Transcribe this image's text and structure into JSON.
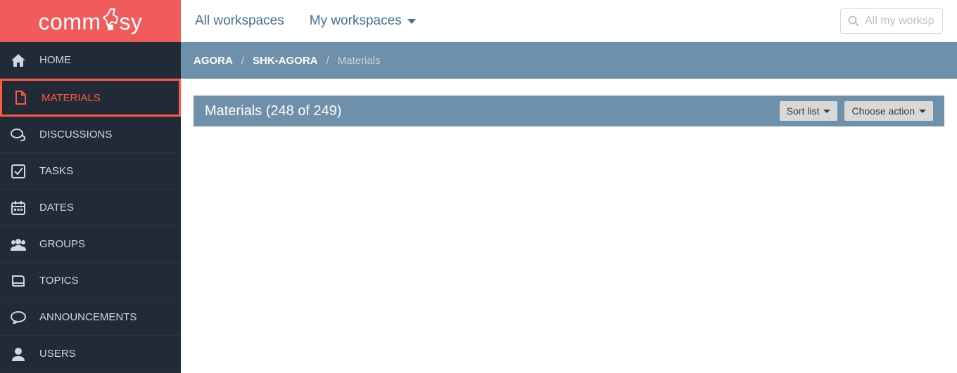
{
  "logo": {
    "text_prefix": "comm",
    "text_suffix": "sy"
  },
  "sidebar": {
    "items": [
      {
        "id": "home",
        "label": "HOME"
      },
      {
        "id": "materials",
        "label": "MATERIALS"
      },
      {
        "id": "discussions",
        "label": "DISCUSSIONS"
      },
      {
        "id": "tasks",
        "label": "TASKS"
      },
      {
        "id": "dates",
        "label": "DATES"
      },
      {
        "id": "groups",
        "label": "GROUPS"
      },
      {
        "id": "topics",
        "label": "TOPICS"
      },
      {
        "id": "announcements",
        "label": "ANNOUNCEMENTS"
      },
      {
        "id": "users",
        "label": "USERS"
      }
    ]
  },
  "topbar": {
    "all_workspaces": "All workspaces",
    "my_workspaces": "My workspaces",
    "search_placeholder": "All my worksp"
  },
  "breadcrumb": {
    "level1": "AGORA",
    "level2": "SHK-AGORA",
    "level3": "Materials"
  },
  "panel": {
    "title": "Materials (248 of 249)",
    "sort_button": "Sort list",
    "action_button": "Choose action"
  }
}
